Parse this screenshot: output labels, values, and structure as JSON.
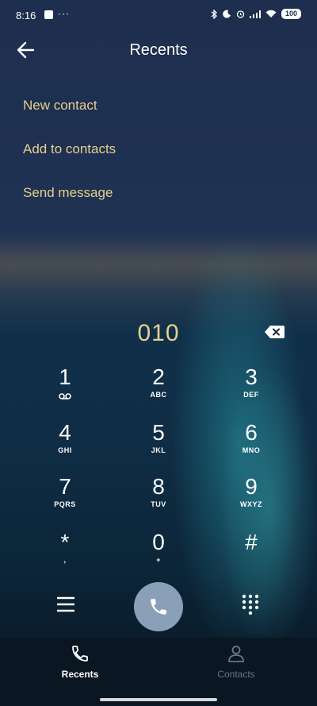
{
  "status_bar": {
    "time": "8:16",
    "dots": "···",
    "battery": "100"
  },
  "header": {
    "title": "Recents"
  },
  "menu": {
    "new_contact": "New contact",
    "add_to_contacts": "Add to contacts",
    "send_message": "Send message"
  },
  "dialer": {
    "entered_number": "010",
    "keys": [
      {
        "digit": "1",
        "letters": ""
      },
      {
        "digit": "2",
        "letters": "ABC"
      },
      {
        "digit": "3",
        "letters": "DEF"
      },
      {
        "digit": "4",
        "letters": "GHI"
      },
      {
        "digit": "5",
        "letters": "JKL"
      },
      {
        "digit": "6",
        "letters": "MNO"
      },
      {
        "digit": "7",
        "letters": "PQRS"
      },
      {
        "digit": "8",
        "letters": "TUV"
      },
      {
        "digit": "9",
        "letters": "WXYZ"
      },
      {
        "digit": "*",
        "letters": ","
      },
      {
        "digit": "0",
        "letters": "+"
      },
      {
        "digit": "#",
        "letters": ""
      }
    ]
  },
  "bottom_nav": {
    "recents": "Recents",
    "contacts": "Contacts",
    "active_tab": "recents"
  },
  "colors": {
    "accent": "#e7cf8f",
    "call_button": "#8aa0b8",
    "inactive_tab": "#6d7580"
  }
}
